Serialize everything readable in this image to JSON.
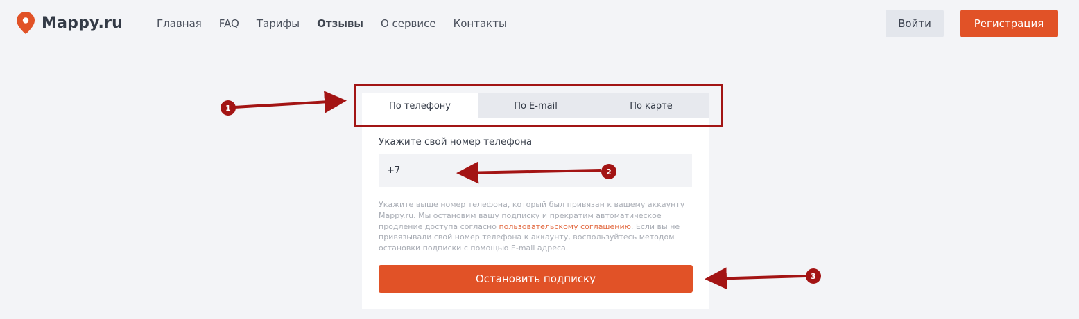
{
  "header": {
    "logo_text": "Mappy.ru",
    "nav": [
      {
        "label": "Главная",
        "active": false
      },
      {
        "label": "FAQ",
        "active": false
      },
      {
        "label": "Тарифы",
        "active": false
      },
      {
        "label": "Отзывы",
        "active": true
      },
      {
        "label": "О сервисе",
        "active": false
      },
      {
        "label": "Контакты",
        "active": false
      }
    ],
    "login_label": "Войти",
    "register_label": "Регистрация"
  },
  "form": {
    "tabs": [
      {
        "label": "По телефону",
        "active": true
      },
      {
        "label": "По E-mail",
        "active": false
      },
      {
        "label": "По карте",
        "active": false
      }
    ],
    "phone_label": "Укажите свой номер телефона",
    "phone_value": "+7",
    "help_text_part1": "Укажите выше номер телефона, который был привязан к вашему аккаунту Mappy.ru. Мы остановим вашу подписку и прекратим автоматическое продление доступа согласно ",
    "help_link": "пользовательскому соглашению",
    "help_text_part2": ". Если вы не привязывали свой номер телефона к аккаунту, воспользуйтесь методом остановки подписки с помощью E-mail адреса.",
    "submit_label": "Остановить подписку"
  },
  "annotations": {
    "markers": [
      "1",
      "2",
      "3"
    ]
  },
  "colors": {
    "accent": "#e15227",
    "annotation": "#a31414",
    "background": "#f3f4f7"
  }
}
